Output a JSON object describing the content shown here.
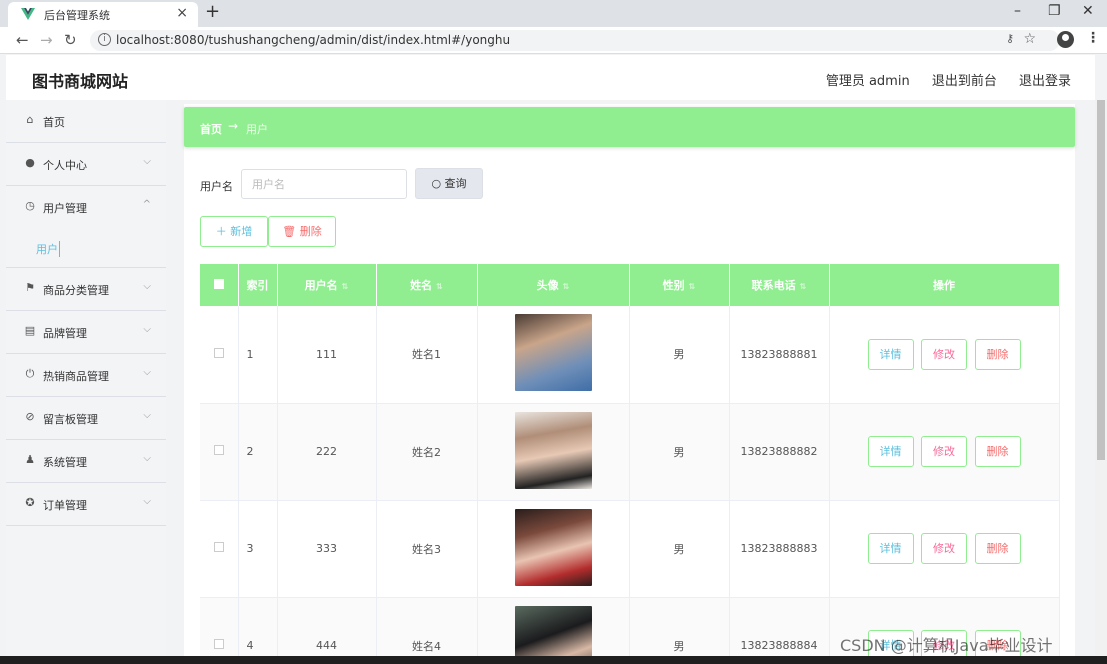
{
  "browser": {
    "tab_title": "后台管理系统",
    "url": "localhost:8080/tushushangcheng/admin/dist/index.html#/yonghu"
  },
  "header": {
    "site_title": "图书商城网站",
    "admin": "管理员 admin",
    "to_front": "退出到前台",
    "logout": "退出登录"
  },
  "sidebar": {
    "items": [
      {
        "label": "首页",
        "icon": "home-icon"
      },
      {
        "label": "个人中心",
        "icon": "user-icon"
      },
      {
        "label": "用户管理",
        "icon": "clock-icon"
      },
      {
        "label": "商品分类管理",
        "icon": "flag-icon"
      },
      {
        "label": "品牌管理",
        "icon": "document-icon"
      },
      {
        "label": "热销商品管理",
        "icon": "power-icon"
      },
      {
        "label": "留言板管理",
        "icon": "bell-off-icon"
      },
      {
        "label": "系统管理",
        "icon": "person-icon"
      },
      {
        "label": "订单管理",
        "icon": "aperture-icon"
      }
    ],
    "sub_item": "用户"
  },
  "breadcrumb": {
    "home": "首页",
    "arrow": "→",
    "current": "用户"
  },
  "search": {
    "label": "用户名",
    "placeholder": "用户名",
    "button": "查询"
  },
  "toolbar": {
    "add": "新增",
    "delete": "删除"
  },
  "table": {
    "headers": [
      "索引",
      "用户名",
      "姓名",
      "头像",
      "性别",
      "联系电话",
      "操作"
    ],
    "rows": [
      {
        "index": "1",
        "username": "111",
        "name": "姓名1",
        "gender": "男",
        "phone": "13823888881"
      },
      {
        "index": "2",
        "username": "222",
        "name": "姓名2",
        "gender": "男",
        "phone": "13823888882"
      },
      {
        "index": "3",
        "username": "333",
        "name": "姓名3",
        "gender": "男",
        "phone": "13823888883"
      },
      {
        "index": "4",
        "username": "444",
        "name": "姓名4",
        "gender": "男",
        "phone": "13823888884"
      }
    ],
    "actions": {
      "detail": "详情",
      "edit": "修改",
      "delete": "删除"
    }
  },
  "watermark": "CSDN @计算机Java毕业设计",
  "colors": {
    "accent": "#90ee90",
    "link": "#5bc0de",
    "danger": "#f56c6c"
  }
}
